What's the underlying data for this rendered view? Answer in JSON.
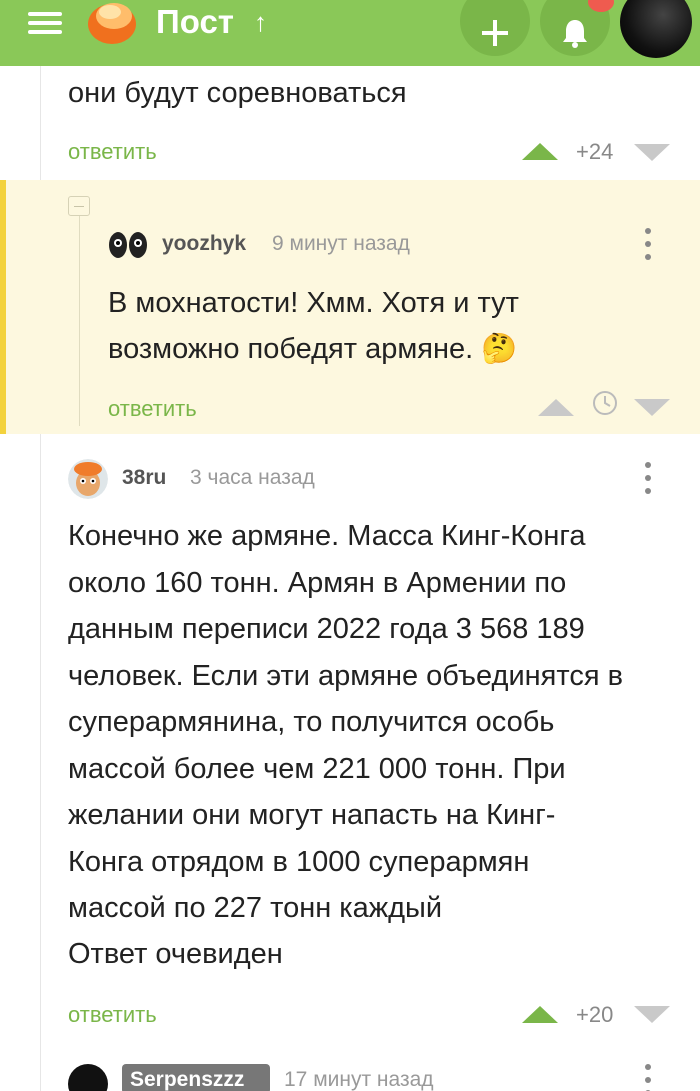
{
  "header": {
    "title": "Пост",
    "up_icon": "arrow-up-icon",
    "add_icon": "plus-icon",
    "bell_icon": "bell-icon",
    "accent": "#8ac858"
  },
  "comments": [
    {
      "text_lines": [
        "они будут соревноваться"
      ],
      "reply_label": "ответить",
      "rating": "+24"
    },
    {
      "author": "yoozhyk",
      "time": "9 минут назад",
      "text_lines": [
        "В мохнатости! Хмм. Хотя и тут",
        "возможно победят армяне. 🤔"
      ],
      "reply_label": "ответить"
    },
    {
      "author": "38ru",
      "time": "3 часа назад",
      "text_lines": [
        "Конечно же армяне. Масса Кинг-Конга",
        "около 160 тонн. Армян в Армении по",
        "данным переписи 2022 года 3 568 189",
        "человек. Если эти армяне объединятся в",
        "суперармянина, то получится особь",
        "массой более чем 221 000 тонн. При",
        "желании они могут напасть на Кинг-",
        "Конга отрядом в 1000 суперармян",
        "массой по 227 тонн каждый",
        "Ответ очевиден"
      ],
      "reply_label": "ответить",
      "rating": "+20"
    },
    {
      "author": "Serpenszzz",
      "time": "17 минут назад"
    }
  ],
  "colors": {
    "highlight_bg": "#fdf8df",
    "highlight_bar": "#f3d23c",
    "vote_up": "#7ab649"
  }
}
